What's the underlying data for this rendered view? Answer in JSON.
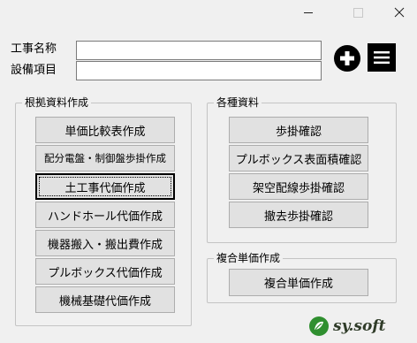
{
  "window": {
    "minimize_icon": "minimize-icon",
    "maximize_icon": "maximize-icon",
    "close_icon": "close-icon"
  },
  "form": {
    "project_name_label": "工事名称",
    "project_name_value": "",
    "equipment_label": "設備項目",
    "equipment_value": "",
    "add_icon": "plus-circle-icon",
    "menu_icon": "hamburger-menu-icon"
  },
  "groups": {
    "basis": {
      "title": "根拠資料作成",
      "buttons": [
        "単価比較表作成",
        "配分電盤・制御盤歩掛作成",
        "土工事代価作成",
        "ハンドホール代価作成",
        "機器搬入・搬出費作成",
        "プルボックス代価作成",
        "機械基礎代価作成"
      ]
    },
    "various": {
      "title": "各種資料",
      "buttons": [
        "歩掛確認",
        "プルボックス表面積確認",
        "架空配線歩掛確認",
        "撤去歩掛確認"
      ]
    },
    "composite": {
      "title": "複合単価作成",
      "buttons": [
        "複合単価作成"
      ]
    }
  },
  "logo": {
    "text": "sy.soft",
    "brand_color": "#2f8f2f"
  }
}
